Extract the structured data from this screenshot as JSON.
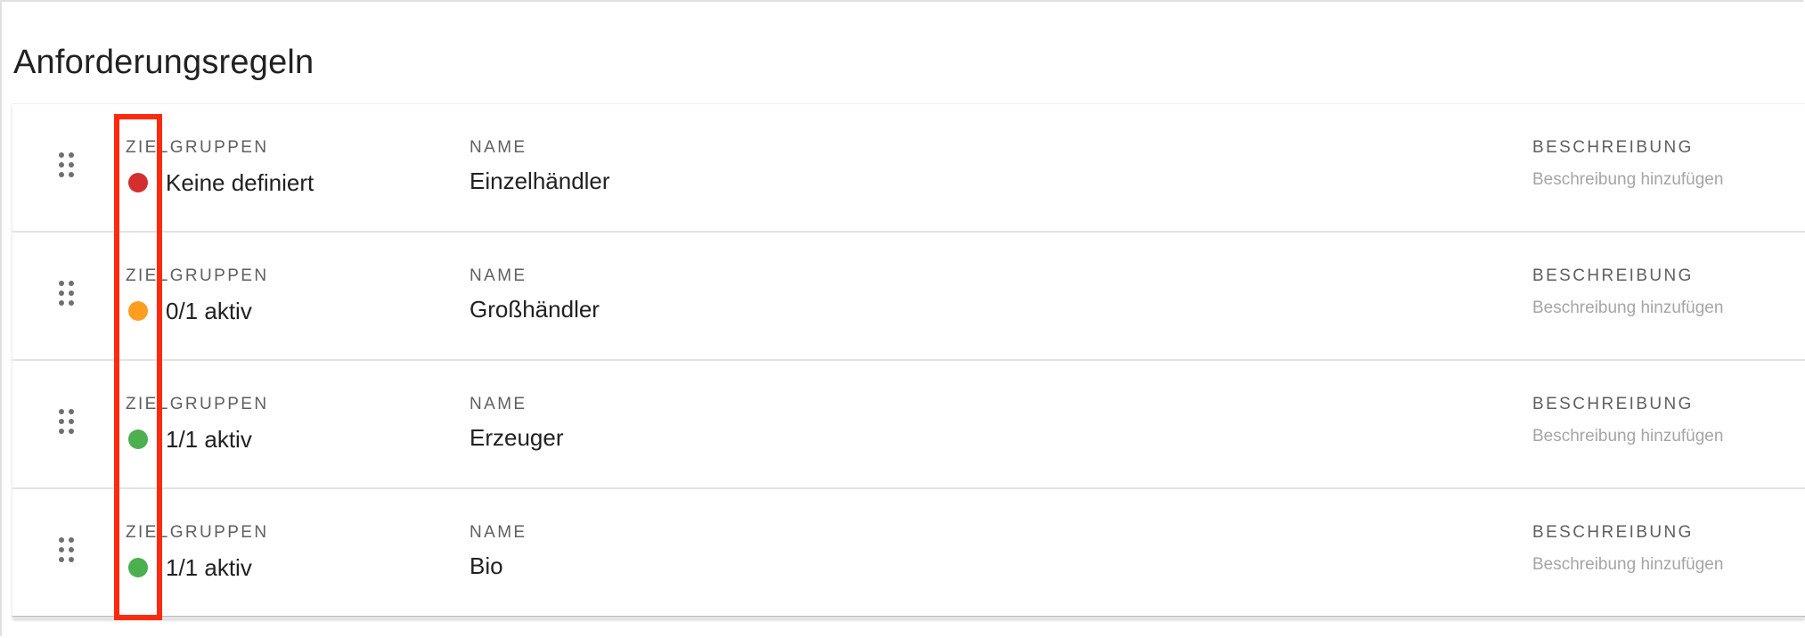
{
  "page": {
    "title": "Anforderungsregeln"
  },
  "colors": {
    "status_none": "#d32f2f",
    "status_partial": "#ff9d1f",
    "status_active": "#4caf50",
    "highlight": "#ff2a0d"
  },
  "columns": {
    "target_groups": "ZIELGRUPPEN",
    "name": "NAME",
    "description": "BESCHREIBUNG"
  },
  "rules": [
    {
      "status": "Keine definiert",
      "status_color": "#d32f2f",
      "name": "Einzelhändler",
      "description_placeholder": "Beschreibung hinzufügen",
      "drag_icon": "drag-handle-icon"
    },
    {
      "status": "0/1 aktiv",
      "status_color": "#ff9d1f",
      "name": "Großhändler",
      "description_placeholder": "Beschreibung hinzufügen",
      "drag_icon": "drag-handle-icon"
    },
    {
      "status": "1/1 aktiv",
      "status_color": "#4caf50",
      "name": "Erzeuger",
      "description_placeholder": "Beschreibung hinzufügen",
      "drag_icon": "drag-handle-icon"
    },
    {
      "status": "1/1 aktiv",
      "status_color": "#4caf50",
      "name": "Bio",
      "description_placeholder": "Beschreibung hinzufügen",
      "drag_icon": "drag-handle-icon"
    }
  ]
}
